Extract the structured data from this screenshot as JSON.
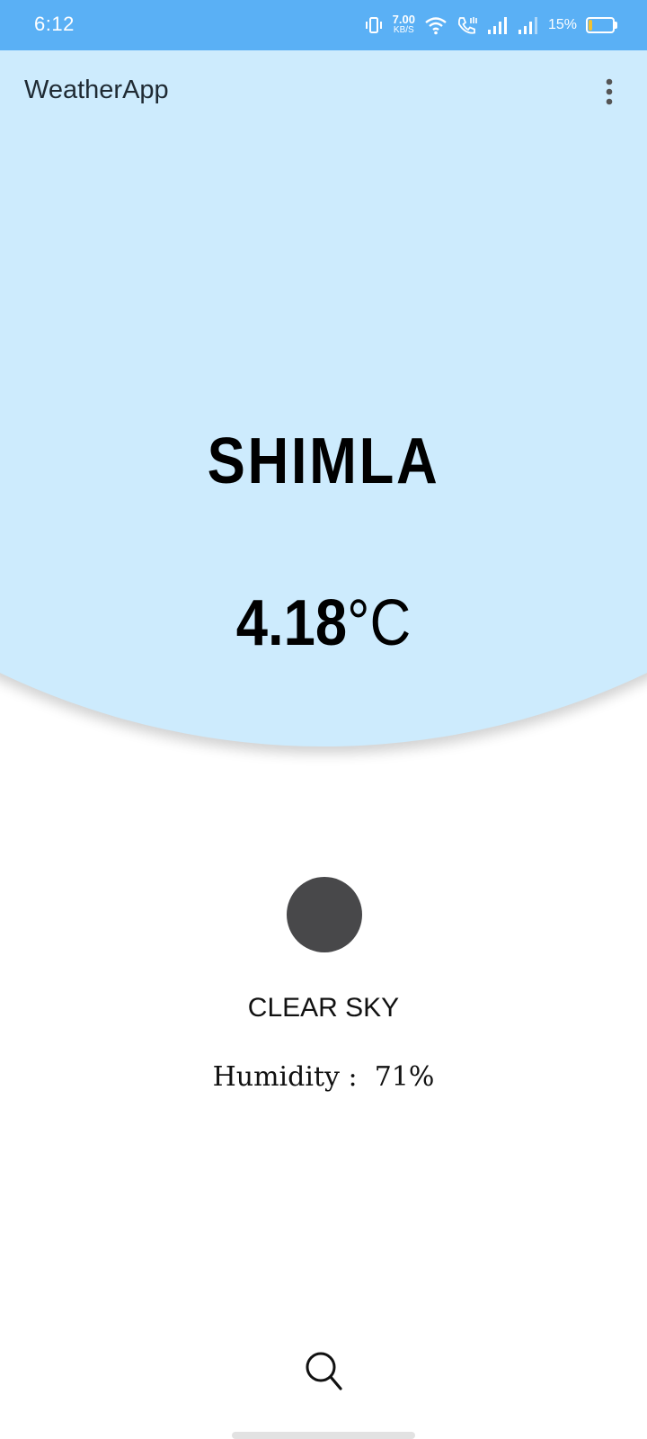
{
  "status_bar": {
    "time": "6:12",
    "net_speed_value": "7.00",
    "net_speed_unit": "KB/S",
    "battery_percent": "15%",
    "battery_level": 0.15,
    "bar_color": "#5ab0f5",
    "icons": [
      "vibrate-icon",
      "wifi-icon",
      "volte-call-icon",
      "signal-icon",
      "signal-icon-2",
      "battery-icon"
    ]
  },
  "app_bar": {
    "title": "WeatherApp",
    "menu_icon": "more-vert-icon"
  },
  "weather": {
    "city": "SHIMLA",
    "temperature_value": "4.18",
    "temperature_unit": "°C",
    "condition_icon": "weather-condition-icon",
    "description": "CLEAR SKY",
    "humidity_label": "Humidity :",
    "humidity_value": "71%"
  },
  "search": {
    "icon": "search-icon"
  },
  "colors": {
    "header_circle": "#cdebfd",
    "status_bar": "#5ab0f5",
    "icon_placeholder": "#48484a"
  }
}
